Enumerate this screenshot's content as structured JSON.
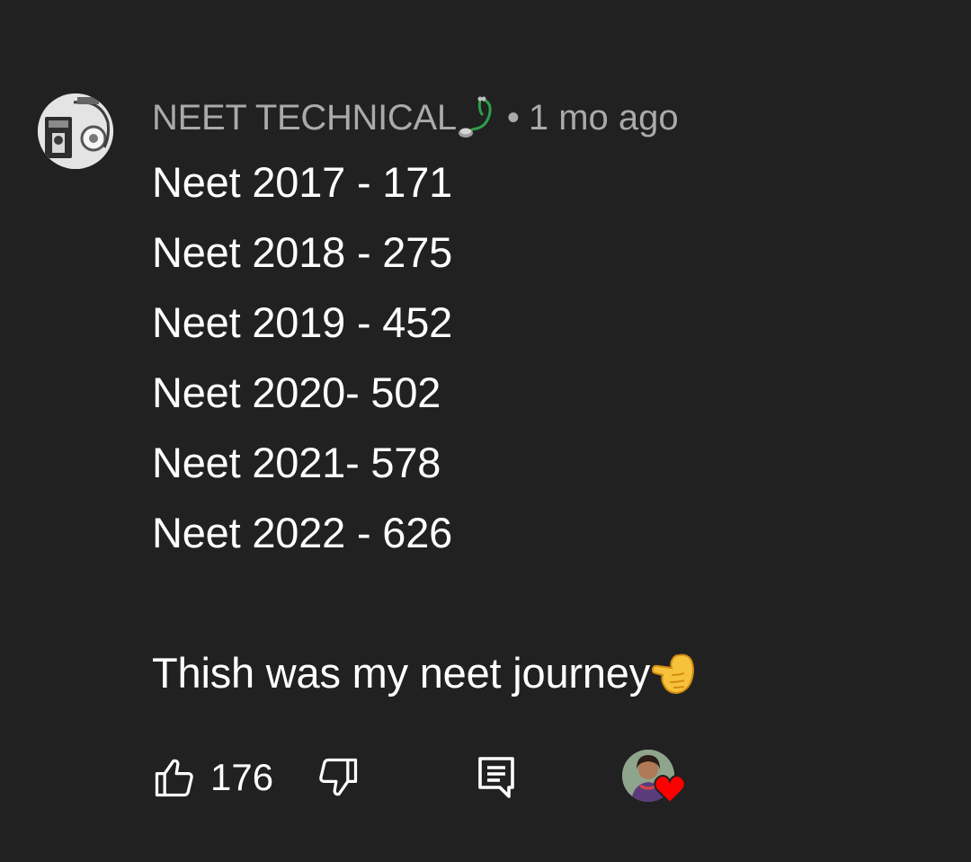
{
  "comment": {
    "author": "NEET TECHNICAL",
    "author_badge_icon": "stethoscope-emoji",
    "separator": "•",
    "timestamp": "1 mo ago",
    "lines": [
      "Neet 2017 - 171",
      "Neet 2018 - 275",
      "Neet 2019 - 452",
      "Neet 2020- 502",
      "Neet 2021- 578",
      "Neet 2022 - 626"
    ],
    "closing_text": "Thish was my neet journey",
    "closing_emoji_icon": "backhand-index-pointing-left-emoji"
  },
  "actions": {
    "like_icon": "thumbs-up-icon",
    "like_count": "176",
    "dislike_icon": "thumbs-down-icon",
    "reply_icon": "comment-reply-icon",
    "creator_heart_icon": "creator-heart-icon"
  },
  "colors": {
    "background": "#212121",
    "primary_text": "#ffffff",
    "secondary_text": "#aaaaaa",
    "heart": "#ff0000"
  }
}
